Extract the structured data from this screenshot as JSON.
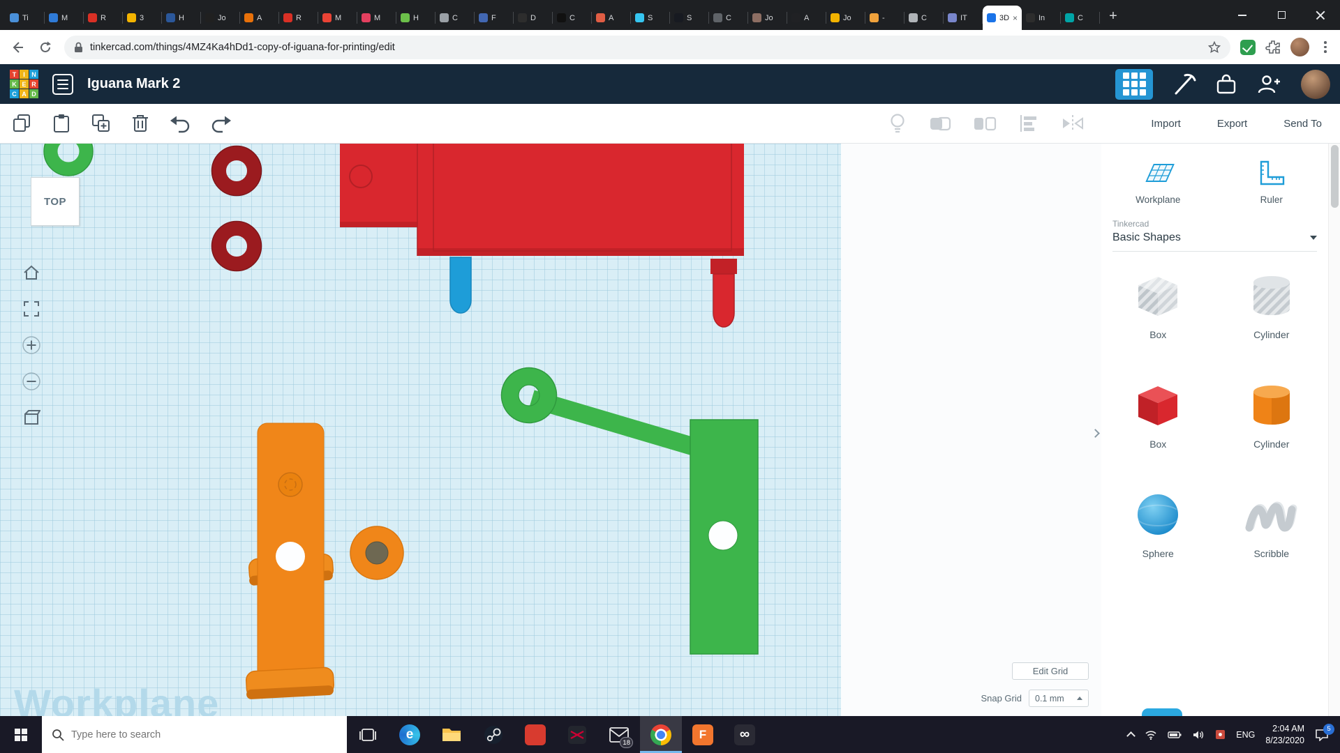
{
  "colors": {
    "accent_blue": "#1e9dd8",
    "red": "#d9272e",
    "dark_red": "#9b1b1f",
    "green": "#3db54b",
    "orange": "#f08619",
    "canvas_grid": "#d9eef6",
    "header_bg": "#16293b",
    "taskbar_bg": "#191926"
  },
  "browser": {
    "tabs": [
      {
        "label": "Ti",
        "color": "#4a90d9"
      },
      {
        "label": "M",
        "color": "#2f7bd8"
      },
      {
        "label": "R",
        "color": "#d93025"
      },
      {
        "label": "3",
        "color": "#f3b300"
      },
      {
        "label": "H",
        "color": "#2b579a"
      },
      {
        "label": "Jo",
        "color": "#202020"
      },
      {
        "label": "A",
        "color": "#e8710a"
      },
      {
        "label": "R",
        "color": "#d93025"
      },
      {
        "label": "M",
        "color": "#ea4335"
      },
      {
        "label": "M",
        "color": "#e4405f"
      },
      {
        "label": "H",
        "color": "#6cc04a"
      },
      {
        "label": "C",
        "color": "#9aa0a6"
      },
      {
        "label": "F",
        "color": "#4267b2"
      },
      {
        "label": "D",
        "color": "#2d2d2d"
      },
      {
        "label": "C",
        "color": "#111111"
      },
      {
        "label": "A",
        "color": "#e05d44"
      },
      {
        "label": "S",
        "color": "#36c5f0"
      },
      {
        "label": "S",
        "color": "#171a21"
      },
      {
        "label": "C",
        "color": "#5f6368"
      },
      {
        "label": "Jo",
        "color": "#8d6e63"
      },
      {
        "label": "A",
        "color": "#202124"
      },
      {
        "label": "Jo",
        "color": "#f3b300"
      },
      {
        "label": "-",
        "color": "#f0a23c"
      },
      {
        "label": "C",
        "color": "#b0b4b8"
      },
      {
        "label": "IT",
        "color": "#7986cb"
      },
      {
        "label": "3D",
        "color": "#1a73e8",
        "active": true
      },
      {
        "label": "In",
        "color": "#2d2d2d"
      },
      {
        "label": "C",
        "color": "#00a4a6"
      }
    ],
    "url": "tinkercad.com/things/4MZ4Ka4hDd1-copy-of-iguana-for-printing/edit"
  },
  "tinkercad": {
    "logo_letters": [
      "T",
      "I",
      "N",
      "K",
      "E",
      "R",
      "C",
      "A",
      "D"
    ],
    "title": "Iguana Mark 2",
    "toolbar": {
      "import": "Import",
      "export": "Export",
      "send_to": "Send To"
    }
  },
  "canvas": {
    "view_cube_label": "TOP",
    "watermark": "Workplane",
    "edit_grid_button": "Edit Grid",
    "snap_grid_label": "Snap Grid",
    "snap_grid_value": "0.1 mm",
    "objects": [
      {
        "name": "green-torus",
        "color": "#3db54b"
      },
      {
        "name": "dark-red-torus-1",
        "color": "#9b1b1f"
      },
      {
        "name": "dark-red-torus-2",
        "color": "#9b1b1f"
      },
      {
        "name": "red-plate",
        "color": "#d9272e"
      },
      {
        "name": "blue-peg",
        "color": "#1e9dd8"
      },
      {
        "name": "red-peg",
        "color": "#d9272e"
      },
      {
        "name": "orange-bracket",
        "color": "#f08619"
      },
      {
        "name": "orange-cylinder",
        "color": "#f08619"
      },
      {
        "name": "green-bracket",
        "color": "#3db54b"
      }
    ]
  },
  "sidebar": {
    "workplane_label": "Workplane",
    "ruler_label": "Ruler",
    "library_label": "Tinkercad",
    "library_value": "Basic Shapes",
    "shapes": [
      {
        "label": "Box"
      },
      {
        "label": "Cylinder"
      },
      {
        "label": "Box"
      },
      {
        "label": "Cylinder"
      },
      {
        "label": "Sphere"
      },
      {
        "label": "Scribble"
      }
    ]
  },
  "taskbar": {
    "search_placeholder": "Type here to search",
    "glyphs": {
      "edge": "e",
      "f_app": "F",
      "infinity": "∞"
    },
    "mail_badge": "18",
    "tray": {
      "language": "ENG",
      "time": "2:04 AM",
      "date": "8/23/2020",
      "notification_badge": "5"
    }
  }
}
